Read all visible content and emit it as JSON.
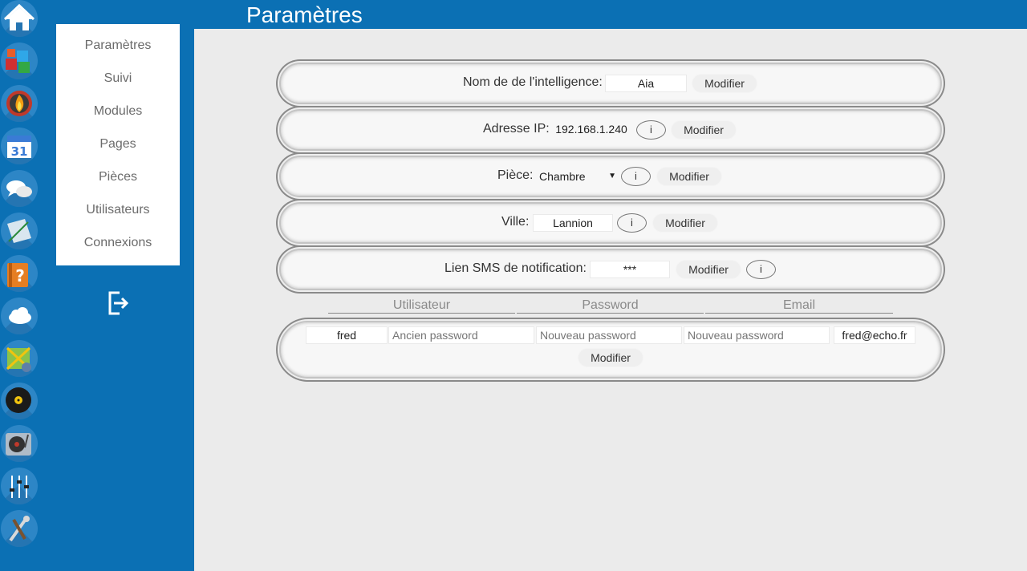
{
  "header": {
    "title": "Paramètres"
  },
  "dock": {
    "items": [
      {
        "icon": "home-icon"
      },
      {
        "icon": "cubes-icon"
      },
      {
        "icon": "fire-icon"
      },
      {
        "icon": "calendar-icon",
        "text": "31"
      },
      {
        "icon": "chat-icon"
      },
      {
        "icon": "notepad-icon"
      },
      {
        "icon": "help-book-icon",
        "text": "?"
      },
      {
        "icon": "cloud-icon"
      },
      {
        "icon": "map-icon"
      },
      {
        "icon": "vinyl-icon"
      },
      {
        "icon": "turntable-icon"
      },
      {
        "icon": "sliders-icon"
      },
      {
        "icon": "tools-icon"
      }
    ]
  },
  "menu": {
    "items": [
      "Paramètres",
      "Suivi",
      "Modules",
      "Pages",
      "Pièces",
      "Utilisateurs",
      "Connexions"
    ],
    "logout_icon": "logout-icon"
  },
  "settings": {
    "name": {
      "label": "Nom de de l'intelligence:",
      "value": "Aia",
      "button": "Modifier"
    },
    "ip": {
      "label": "Adresse IP:",
      "value": "192.168.1.240",
      "info": "i",
      "button": "Modifier"
    },
    "room": {
      "label": "Pièce:",
      "value": "Chambre",
      "info": "i",
      "button": "Modifier"
    },
    "city": {
      "label": "Ville:",
      "value": "Lannion",
      "info": "i",
      "button": "Modifier"
    },
    "sms": {
      "label": "Lien SMS de notification:",
      "value": "***",
      "button": "Modifier",
      "info": "i"
    }
  },
  "users": {
    "headers": [
      "Utilisateur",
      "Password",
      "Email"
    ],
    "row": {
      "username": "fred",
      "old_password_placeholder": "Ancien password",
      "new_password_placeholder": "Nouveau password",
      "confirm_password_placeholder": "Nouveau password",
      "email": "fred@echo.fr",
      "button": "Modifier"
    }
  },
  "colors": {
    "primary_blue": "#0b70b4",
    "background": "#ebebeb"
  }
}
